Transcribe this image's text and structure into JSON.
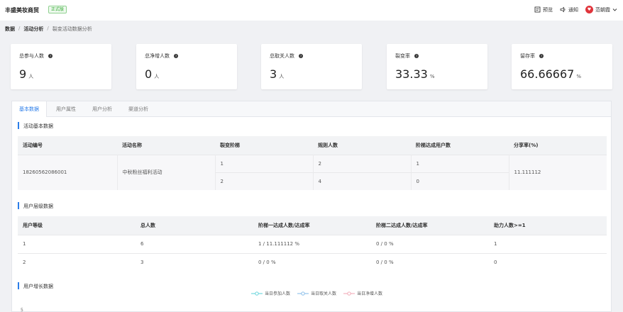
{
  "header": {
    "brand": "丰盛美妆商贸",
    "edition": "正式版",
    "actions": [
      {
        "icon": "preview-icon",
        "label": "预览"
      },
      {
        "icon": "bell-icon",
        "label": "通知"
      },
      {
        "icon": "avatar",
        "label": "范朝霞"
      }
    ]
  },
  "breadcrumb": [
    "数据",
    "活动分析",
    "裂变活动数据分析"
  ],
  "stats": [
    {
      "label": "总参与人数",
      "value": "9",
      "unit": "人"
    },
    {
      "label": "总净增人数",
      "value": "0",
      "unit": "人"
    },
    {
      "label": "总取关人数",
      "value": "3",
      "unit": "人"
    },
    {
      "label": "裂变率",
      "value": "33.33",
      "unit": "%"
    },
    {
      "label": "留存率",
      "value": "66.66667",
      "unit": "%"
    }
  ],
  "tabs": [
    "基本数据",
    "用户属性",
    "用户分析",
    "渠道分析"
  ],
  "activity_section": {
    "title": "活动基本数据",
    "columns": [
      "活动编号",
      "活动名称",
      "裂变阶梯",
      "规则人数",
      "阶梯达成用户数",
      "分享率(%)"
    ],
    "activity_id": "18260562086001",
    "activity_name": "中秋粉丝福利活动",
    "share_rate": "11.111112",
    "tiers": [
      {
        "tier": "1",
        "rule": "2",
        "reached": "1"
      },
      {
        "tier": "2",
        "rule": "4",
        "reached": "0"
      }
    ]
  },
  "level_section": {
    "title": "用户层级数据",
    "columns": [
      "用户等级",
      "总人数",
      "阶梯一达成人数/达成率",
      "阶梯二达成人数/达成率",
      "助力人数>=1"
    ],
    "rows": [
      [
        "1",
        "6",
        "1 / 11.111112 %",
        "0 / 0 %",
        "1"
      ],
      [
        "2",
        "3",
        "0 / 0 %",
        "0 / 0 %",
        "0"
      ]
    ]
  },
  "growth_section": {
    "title": "用户增长数据",
    "legend": [
      {
        "name": "当日参加人数",
        "color": "#5ad0d8"
      },
      {
        "name": "当日取关人数",
        "color": "#7fb8e8"
      },
      {
        "name": "当日净增人数",
        "color": "#f0a3b0"
      }
    ],
    "y_tick": "5"
  }
}
